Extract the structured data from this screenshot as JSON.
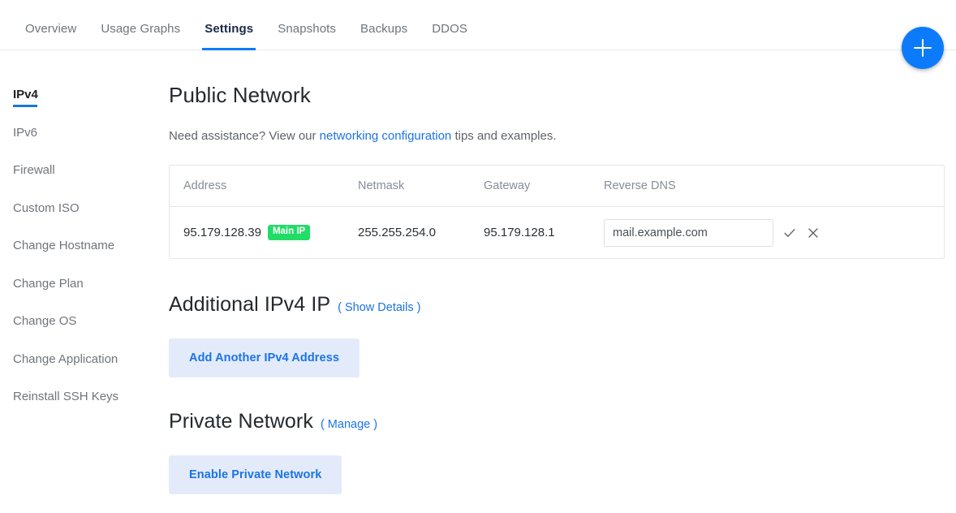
{
  "header": {
    "tabs": [
      {
        "label": "Overview",
        "active": false
      },
      {
        "label": "Usage Graphs",
        "active": false
      },
      {
        "label": "Settings",
        "active": true
      },
      {
        "label": "Snapshots",
        "active": false
      },
      {
        "label": "Backups",
        "active": false
      },
      {
        "label": "DDOS",
        "active": false
      }
    ],
    "fab": {
      "icon": "plus-icon",
      "color": "#0b7bfb"
    }
  },
  "sidebar": {
    "items": [
      {
        "label": "IPv4",
        "active": true
      },
      {
        "label": "IPv6",
        "active": false
      },
      {
        "label": "Firewall",
        "active": false
      },
      {
        "label": "Custom ISO",
        "active": false
      },
      {
        "label": "Change Hostname",
        "active": false
      },
      {
        "label": "Change Plan",
        "active": false
      },
      {
        "label": "Change OS",
        "active": false
      },
      {
        "label": "Change Application",
        "active": false
      },
      {
        "label": "Reinstall SSH Keys",
        "active": false
      }
    ]
  },
  "main": {
    "public_network": {
      "title": "Public Network",
      "assist_prefix": "Need assistance? View our ",
      "assist_link": "networking configuration",
      "assist_suffix": " tips and examples.",
      "table": {
        "columns": [
          "Address",
          "Netmask",
          "Gateway",
          "Reverse DNS"
        ],
        "rows": [
          {
            "address": "95.179.128.39",
            "badge": "Main IP",
            "netmask": "255.255.254.0",
            "gateway": "95.179.128.1",
            "reverse_dns_value": "mail.example.com",
            "reverse_dns_placeholder": "Reverse DNS",
            "confirm_icon": "check-icon",
            "cancel_icon": "close-icon"
          }
        ]
      }
    },
    "additional_ipv4": {
      "title": "Additional IPv4 IP",
      "link": "( Show Details )",
      "button": "Add Another IPv4 Address"
    },
    "private_network": {
      "title": "Private Network",
      "link": "( Manage )",
      "button": "Enable Private Network"
    }
  },
  "colors": {
    "accent": "#0b7bfb",
    "link": "#1a73e8",
    "badge_green": "#21dd68",
    "button_bg": "#e3ebfb"
  }
}
